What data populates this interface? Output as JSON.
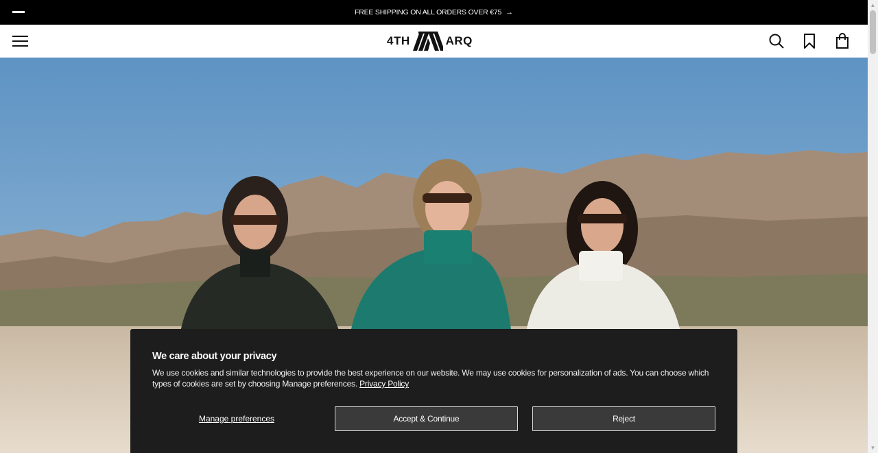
{
  "announcement": {
    "text": "FREE SHIPPING ON ALL ORDERS OVER €75",
    "arrow": "→"
  },
  "header": {
    "logo": {
      "left": "4TH",
      "right": "ARQ"
    },
    "icons": [
      "menu-icon",
      "search-icon",
      "bookmark-icon",
      "bag-icon"
    ]
  },
  "hero": {
    "alt": ""
  },
  "cookie": {
    "title": "We care about your privacy",
    "body": "We use cookies and similar technologies to provide the best experience on our website. We may use cookies for personalization of ads. You can choose which types of cookies are set by choosing Manage preferences.",
    "policy_link": "Privacy Policy",
    "manage_label": "Manage preferences",
    "accept_label": "Accept & Continue",
    "reject_label": "Reject"
  },
  "colors": {
    "bar": "#000000",
    "banner": "#1d1d1d",
    "button": "#3a3a3a"
  }
}
